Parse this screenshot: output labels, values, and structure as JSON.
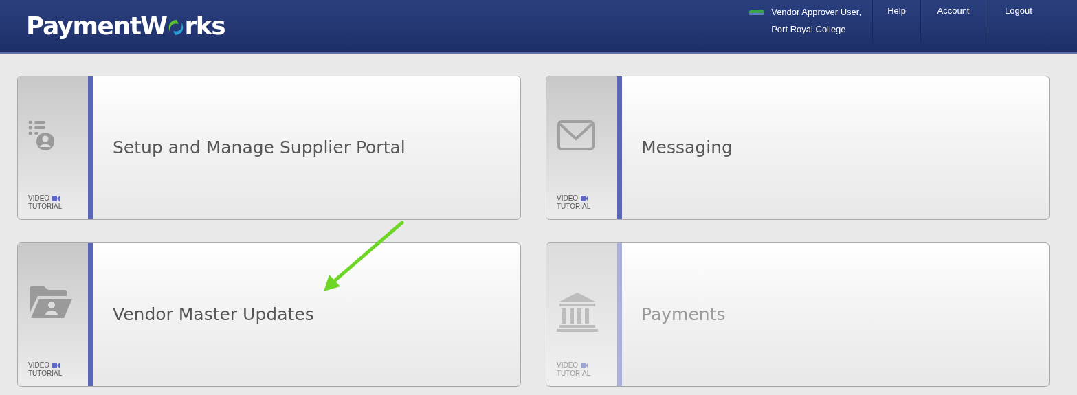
{
  "header": {
    "logo": {
      "before": "PaymentW",
      "after": "rks"
    },
    "user": {
      "name": "Vendor Approver User,",
      "org": "Port Royal College"
    },
    "links": [
      "Help",
      "Account",
      "Logout"
    ]
  },
  "tiles": [
    {
      "title": "Setup and Manage Supplier Portal",
      "kind": "portal",
      "video": "VIDEO",
      "tutorial": "TUTORIAL",
      "disabled": false
    },
    {
      "title": "Messaging",
      "kind": "envelope",
      "video": "VIDEO",
      "tutorial": "TUTORIAL",
      "disabled": false
    },
    {
      "title": "Vendor Master Updates",
      "kind": "folder",
      "video": "VIDEO",
      "tutorial": "TUTORIAL",
      "disabled": false
    },
    {
      "title": "Payments",
      "kind": "bank",
      "video": "VIDEO",
      "tutorial": "TUTORIAL",
      "disabled": true
    }
  ]
}
